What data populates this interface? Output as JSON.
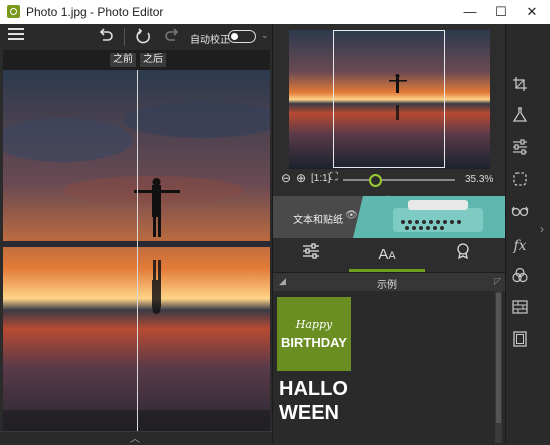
{
  "window": {
    "title": "Photo 1.jpg - Photo Editor",
    "controls": {
      "minimize": "—",
      "maximize": "☐",
      "close": "✕"
    }
  },
  "toolbar": {
    "auto_correct_label": "自动校正",
    "auto_correct_on": false,
    "icons": [
      "menu-icon",
      "undo-icon",
      "rotate-icon",
      "redo-icon"
    ]
  },
  "compare": {
    "before": "之前",
    "after": "之后"
  },
  "navigator": {
    "zoom_percent": "35.3%",
    "zoom_slider_fraction": 0.25,
    "zoom_buttons": [
      "zoom-out-icon",
      "zoom-in-icon",
      "actual-size-icon",
      "fit-icon"
    ]
  },
  "banner": {
    "label": "文本和贴纸"
  },
  "tabs": [
    {
      "name": "adjust-tab",
      "icon": "sliders-icon",
      "active": false
    },
    {
      "name": "text-tab",
      "icon": "text-icon",
      "active": true
    },
    {
      "name": "stickers-tab",
      "icon": "badge-icon",
      "active": false
    }
  ],
  "section": {
    "title": "示例"
  },
  "samples": {
    "birthday": {
      "line1": "Happy",
      "line2": "BIRTHDAY",
      "color": "#6b8e23"
    },
    "halloween": {
      "line1": "HALLO",
      "line2": "WEEN"
    }
  },
  "right_tools": [
    "crop-icon",
    "flask-icon",
    "adjust-icon",
    "selection-icon",
    "glasses-icon",
    "fx-icon",
    "color-mix-icon",
    "texture-icon",
    "frame-icon"
  ],
  "colors": {
    "accent": "#6e9f1e",
    "panel": "#2d2d2d"
  }
}
